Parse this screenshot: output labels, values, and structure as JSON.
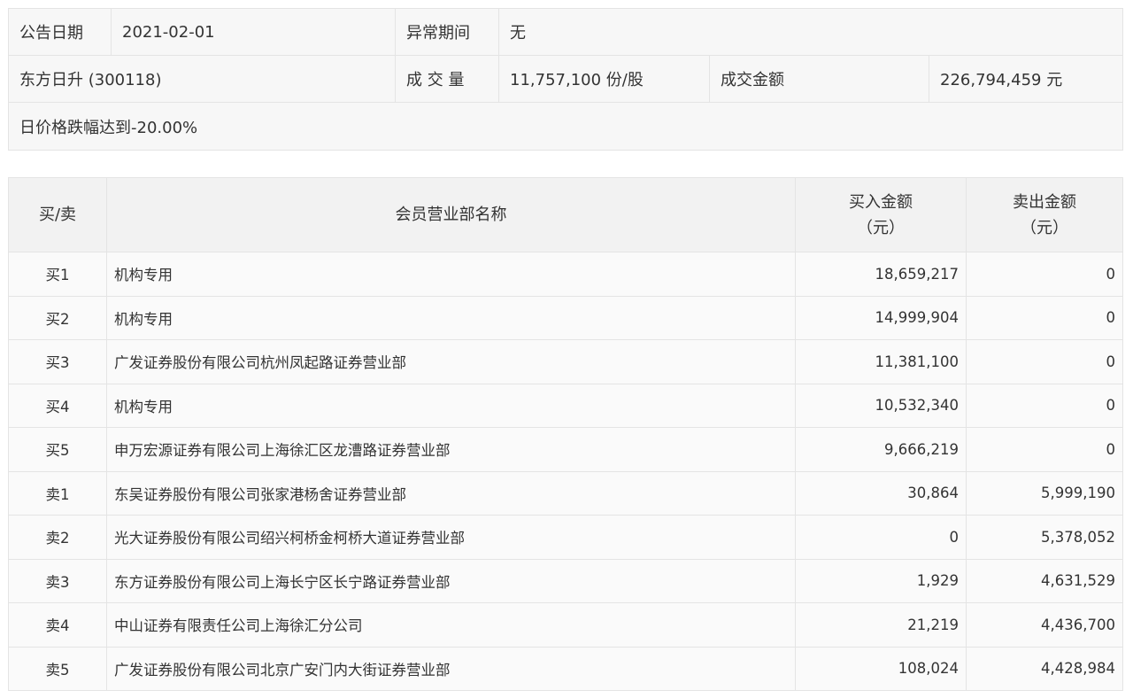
{
  "summary": {
    "date_label": "公告日期",
    "date_value": "2021-02-01",
    "abnormal_label": "异常期间",
    "abnormal_value": "无",
    "stock": "东方日升 (300118)",
    "volume_label": "成 交 量",
    "volume_value": "11,757,100 份/股",
    "turnover_label": "成交金额",
    "turnover_value": "226,794,459 元",
    "reason": "日价格跌幅达到-20.00%"
  },
  "table": {
    "headers": {
      "side": "买/卖",
      "member": "会员营业部名称",
      "buy_line1": "买入金额",
      "buy_line2": "（元）",
      "sell_line1": "卖出金额",
      "sell_line2": "（元）"
    },
    "rows": [
      {
        "side": "买1",
        "name": "机构专用",
        "buy": "18,659,217",
        "sell": "0"
      },
      {
        "side": "买2",
        "name": "机构专用",
        "buy": "14,999,904",
        "sell": "0"
      },
      {
        "side": "买3",
        "name": "广发证券股份有限公司杭州凤起路证券营业部",
        "buy": "11,381,100",
        "sell": "0"
      },
      {
        "side": "买4",
        "name": "机构专用",
        "buy": "10,532,340",
        "sell": "0"
      },
      {
        "side": "买5",
        "name": "申万宏源证券有限公司上海徐汇区龙漕路证券营业部",
        "buy": "9,666,219",
        "sell": "0"
      },
      {
        "side": "卖1",
        "name": "东吴证券股份有限公司张家港杨舍证券营业部",
        "buy": "30,864",
        "sell": "5,999,190"
      },
      {
        "side": "卖2",
        "name": "光大证券股份有限公司绍兴柯桥金柯桥大道证券营业部",
        "buy": "0",
        "sell": "5,378,052"
      },
      {
        "side": "卖3",
        "name": "东方证券股份有限公司上海长宁区长宁路证券营业部",
        "buy": "1,929",
        "sell": "4,631,529"
      },
      {
        "side": "卖4",
        "name": "中山证券有限责任公司上海徐汇分公司",
        "buy": "21,219",
        "sell": "4,436,700"
      },
      {
        "side": "卖5",
        "name": "广发证券股份有限公司北京广安门内大街证券营业部",
        "buy": "108,024",
        "sell": "4,428,984"
      }
    ]
  }
}
